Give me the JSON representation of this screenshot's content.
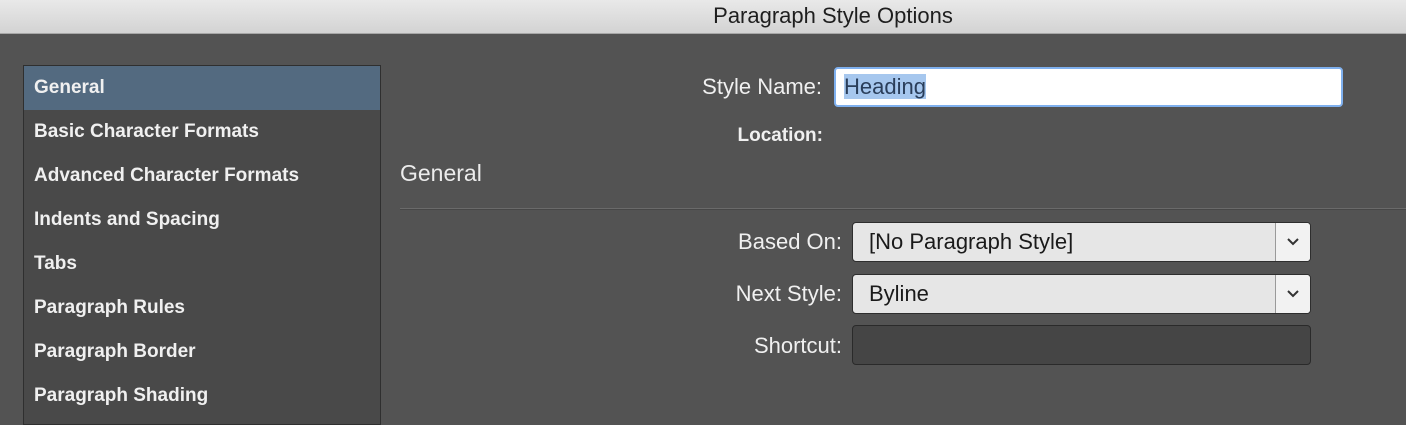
{
  "window": {
    "title": "Paragraph Style Options"
  },
  "sidebar": {
    "items": [
      {
        "label": "General",
        "selected": true
      },
      {
        "label": "Basic Character Formats"
      },
      {
        "label": "Advanced Character Formats"
      },
      {
        "label": "Indents and Spacing"
      },
      {
        "label": "Tabs"
      },
      {
        "label": "Paragraph Rules"
      },
      {
        "label": "Paragraph Border"
      },
      {
        "label": "Paragraph Shading"
      }
    ]
  },
  "form": {
    "style_name_label": "Style Name:",
    "style_name_value": "Heading",
    "location_label": "Location:",
    "section_title": "General",
    "based_on_label": "Based On:",
    "based_on_value": "[No Paragraph Style]",
    "next_style_label": "Next Style:",
    "next_style_value": "Byline",
    "shortcut_label": "Shortcut:",
    "shortcut_value": ""
  },
  "icons": {
    "dropdown": "chevron-down-icon"
  },
  "colors": {
    "background": "#535353",
    "sidebar_bg": "#494949",
    "selection": "#536a80",
    "focus_ring": "#7fb0ee",
    "text_selection": "#a6c7ee"
  }
}
